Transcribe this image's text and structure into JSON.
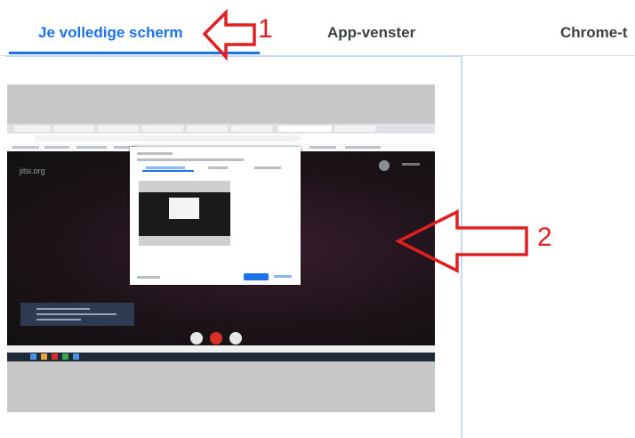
{
  "tabs": [
    {
      "label": "Je volledige scherm",
      "selected": true
    },
    {
      "label": "App-venster",
      "selected": false
    },
    {
      "label": "Chrome-t",
      "selected": false
    }
  ],
  "preview": {
    "app_logo_text": "jitsi.org"
  },
  "annotations": {
    "label_1": "1",
    "label_2": "2",
    "color": "#e02020"
  },
  "colors": {
    "accent": "#1a73e8",
    "tab_text": "#3c4043",
    "preview_border": "#c6daf6"
  }
}
